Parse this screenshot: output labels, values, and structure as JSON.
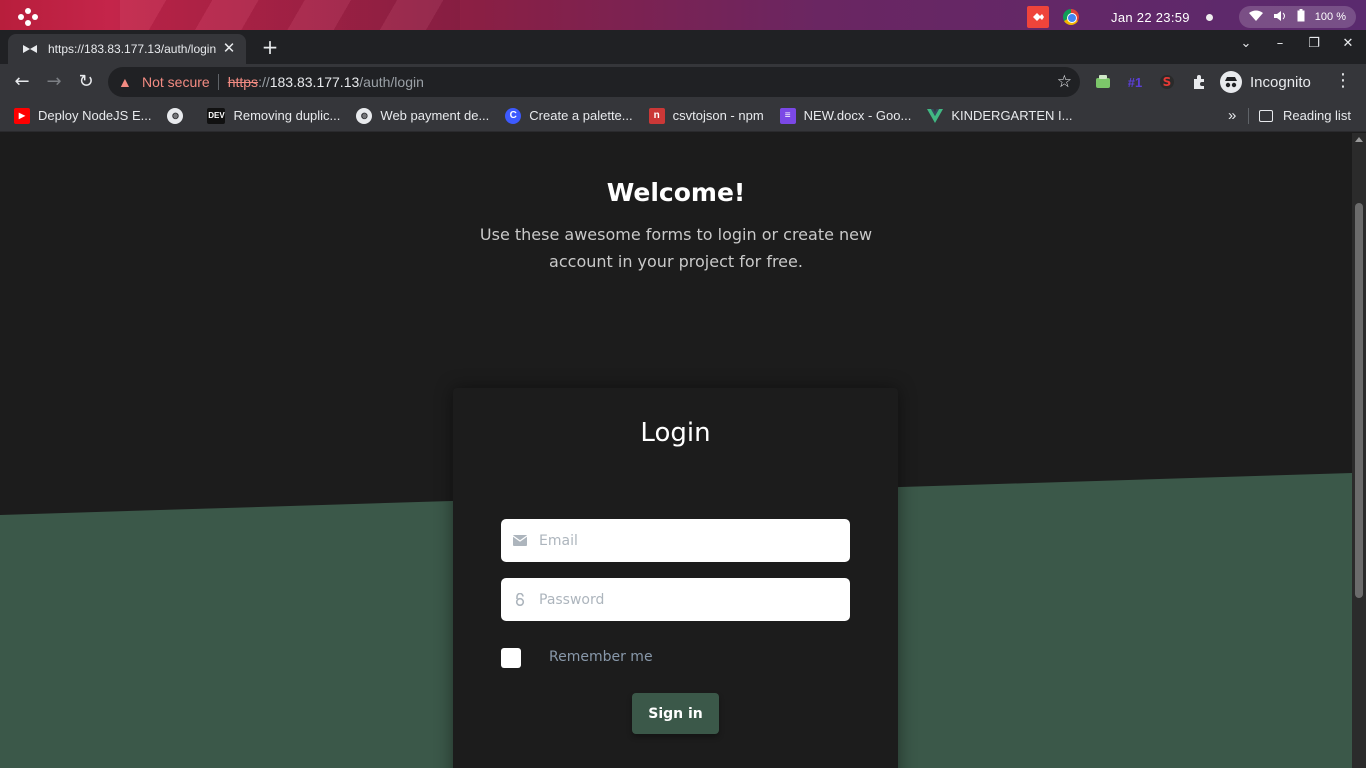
{
  "os": {
    "datetime": "Jan 22  23:59",
    "battery": "100 %"
  },
  "tab": {
    "title": "https://183.83.177.13/auth/login",
    "close": "✕"
  },
  "toolbar": {
    "not_secure": "Not secure",
    "url_scheme": "https",
    "url_sep": "://",
    "url_host": "183.83.177.13",
    "url_path": "/auth/login",
    "incognito": "Incognito",
    "ext_badge": "#1"
  },
  "bookmarks": [
    {
      "label": "Deploy NodeJS E...",
      "icon": "youtube-icon"
    },
    {
      "label": "",
      "icon": "globe-icon"
    },
    {
      "label": "Removing duplic...",
      "icon": "dev-icon"
    },
    {
      "label": "Web payment de...",
      "icon": "globe-icon"
    },
    {
      "label": "Create a palette...",
      "icon": "coolors-icon"
    },
    {
      "label": "csvtojson - npm",
      "icon": "npm-icon"
    },
    {
      "label": "NEW.docx - Goo...",
      "icon": "docs-icon"
    },
    {
      "label": "KINDERGARTEN I...",
      "icon": "vue-icon"
    }
  ],
  "reading_list": "Reading list",
  "page": {
    "welcome": "Welcome!",
    "subtitle": "Use these awesome forms to login or create new account in your project for free.",
    "login_title": "Login",
    "email_placeholder": "Email",
    "password_placeholder": "Password",
    "remember_me": "Remember me",
    "sign_in": "Sign in"
  },
  "colors": {
    "accent_green": "#3b5849",
    "page_dark": "#1c1c1c",
    "warning_red": "#f28b82"
  }
}
